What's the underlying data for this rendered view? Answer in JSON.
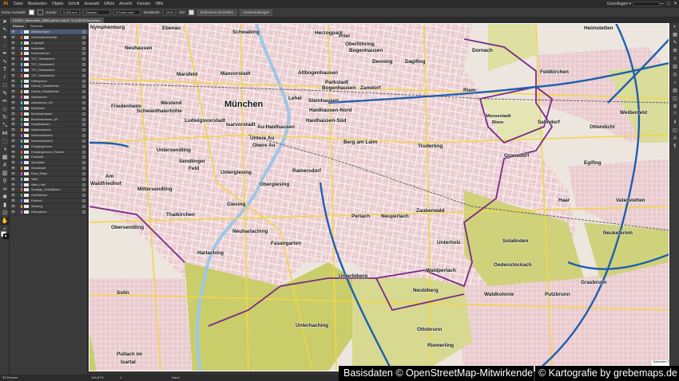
{
  "menubar": {
    "logo": "Ai",
    "items": [
      "Datei",
      "Bearbeiten",
      "Objekt",
      "Schrift",
      "Auswahl",
      "Effekt",
      "Ansicht",
      "Fenster",
      "Hilfe"
    ],
    "workspace": "Grundlagen ▾",
    "window_controls": [
      "—",
      "□",
      "✕"
    ]
  },
  "controlbar": {
    "selection_label": "Keine Auswahl",
    "stroke_label": "Kontur:",
    "stroke_value": "0,353 mm",
    "brush_value": "Gleichm.",
    "style_value": "3 Punkt rund",
    "opacity_label": "Deckkraft:",
    "opacity_value": "100%",
    "style_label": "Stil:",
    "doc_setup_button": "Dokument einrichten",
    "preferences_button": "Voreinstellungen"
  },
  "document_tab": "210001_Muenchen_4000.pdf bei 146,67 % (CMYK/Vorschau)",
  "layers_panel": {
    "tabs": [
      "Ebenen",
      "Zeichenf."
    ],
    "layers": [
      {
        "name": "Allesanzeigen",
        "color": "#4f7cff"
      },
      {
        "name": "Kartenrahmeninhalt",
        "color": "#ff4f4f"
      },
      {
        "name": "Copyright",
        "color": "#3fbf3f"
      },
      {
        "name": "Kartentitel",
        "color": "#4f7cff"
      },
      {
        "name": "Kartenrahmen",
        "color": "#ff9f2f"
      },
      {
        "name": "TXT_Ortsnamen1",
        "color": "#d04fd0"
      },
      {
        "name": "TXT_Ortsnamen2",
        "color": "#4fd0d0"
      },
      {
        "name": "TXT_Ortsnamen3",
        "color": "#4f7cff"
      },
      {
        "name": "TXT_Ortsnamen4",
        "color": "#ff4f4f"
      },
      {
        "name": "Haltegrenze",
        "color": "#3fbf3f"
      },
      {
        "name": "Grenze_Stadtbezirke",
        "color": "#4f7cff"
      },
      {
        "name": "Grenze_Stadtbezirke",
        "color": "#ff9f2f"
      },
      {
        "name": "Autobahnen",
        "color": "#d04fd0"
      },
      {
        "name": "Autobahnen_AS",
        "color": "#4fd0d0"
      },
      {
        "name": "Eisenbahn",
        "color": "#4f7cff"
      },
      {
        "name": "Bundesstrassen",
        "color": "#ff4f4f"
      },
      {
        "name": "Bundesstrassen_AS",
        "color": "#3fbf3f"
      },
      {
        "name": "Hauptstrassen",
        "color": "#4f7cff"
      },
      {
        "name": "Nebenstrassen",
        "color": "#ff9f2f"
      },
      {
        "name": "Nebenstrassen2",
        "color": "#d04fd0"
      },
      {
        "name": "Nebenstrassen3",
        "color": "#4fd0d0"
      },
      {
        "name": "Fußgängerzone",
        "color": "#4f7cff"
      },
      {
        "name": "Fußgängerzone_Flaeche",
        "color": "#ff4f4f"
      },
      {
        "name": "Parkplatz",
        "color": "#3fbf3f"
      },
      {
        "name": "Sportplatz",
        "color": "#4f7cff"
      },
      {
        "name": "Gewaesser",
        "color": "#ff9f2f"
      },
      {
        "name": "Plant_Retail",
        "color": "#d04fd0"
      },
      {
        "name": "Wald",
        "color": "#4fd0d0"
      },
      {
        "name": "Wald_Park",
        "color": "#4f7cff"
      },
      {
        "name": "Sonstige_Grünflächen",
        "color": "#ff4f4f"
      },
      {
        "name": "Grünflächen",
        "color": "#3fbf3f"
      },
      {
        "name": "Friedhof",
        "color": "#4f7cff"
      },
      {
        "name": "Siedlung",
        "color": "#ff9f2f"
      },
      {
        "name": "Hintergrund",
        "color": "#d04fd0"
      }
    ]
  },
  "statusbar": {
    "layers_count": "35 Ebenen",
    "zoom": "146,67%",
    "page": "1",
    "tool": "Hand"
  },
  "map": {
    "places": [
      {
        "name": "Nymphenburg",
        "cls": ""
      },
      {
        "name": "Ebenau",
        "cls": ""
      },
      {
        "name": "Schwabing",
        "cls": ""
      },
      {
        "name": "Herzogpark",
        "cls": ""
      },
      {
        "name": "Priel",
        "cls": ""
      },
      {
        "name": "Oberföhring",
        "cls": ""
      },
      {
        "name": "Bogenhausen",
        "cls": ""
      },
      {
        "name": "Dornach",
        "cls": ""
      },
      {
        "name": "Heimstetten",
        "cls": ""
      },
      {
        "name": "Neuhausen",
        "cls": ""
      },
      {
        "name": "Denning",
        "cls": ""
      },
      {
        "name": "Daglfing",
        "cls": ""
      },
      {
        "name": "Marsfeld",
        "cls": ""
      },
      {
        "name": "Maxvorstadt",
        "cls": ""
      },
      {
        "name": "Altbogenhausen",
        "cls": ""
      },
      {
        "name": "Parkstadt",
        "cls": ""
      },
      {
        "name": "Bogenhausen",
        "cls": ""
      },
      {
        "name": "Zamdorf",
        "cls": ""
      },
      {
        "name": "Feldkirchen",
        "cls": ""
      },
      {
        "name": "Riem",
        "cls": ""
      },
      {
        "name": "Lehel",
        "cls": ""
      },
      {
        "name": "Haidhausen-Nord",
        "cls": ""
      },
      {
        "name": "Steinhausen",
        "cls": ""
      },
      {
        "name": "Westend",
        "cls": ""
      },
      {
        "name": "München",
        "cls": "big"
      },
      {
        "name": "Friedenheim",
        "cls": ""
      },
      {
        "name": "Schwanthalerhöhe",
        "cls": ""
      },
      {
        "name": "Ludwigsvorstadt",
        "cls": ""
      },
      {
        "name": "Isarvorstadt",
        "cls": ""
      },
      {
        "name": "Au-Haidhausen",
        "cls": ""
      },
      {
        "name": "Haidhausen-Süd",
        "cls": ""
      },
      {
        "name": "Messestadt",
        "cls": "small"
      },
      {
        "name": "Riem",
        "cls": "small"
      },
      {
        "name": "Salmdorf",
        "cls": ""
      },
      {
        "name": "Weißenfeld",
        "cls": ""
      },
      {
        "name": "Ottendichl",
        "cls": ""
      },
      {
        "name": "Untere Au",
        "cls": ""
      },
      {
        "name": "Obere Au",
        "cls": ""
      },
      {
        "name": "Berg am Laim",
        "cls": ""
      },
      {
        "name": "Truderling",
        "cls": ""
      },
      {
        "name": "Untersendling",
        "cls": ""
      },
      {
        "name": "Gronsdorf",
        "cls": ""
      },
      {
        "name": "Sendlinger",
        "cls": ""
      },
      {
        "name": "Feld",
        "cls": ""
      },
      {
        "name": "Ramersdorf",
        "cls": ""
      },
      {
        "name": "Eglfing",
        "cls": ""
      },
      {
        "name": "Am",
        "cls": ""
      },
      {
        "name": "Waldfriedhof",
        "cls": ""
      },
      {
        "name": "Untergiesing",
        "cls": ""
      },
      {
        "name": "Mittersendling",
        "cls": ""
      },
      {
        "name": "Obergiesing",
        "cls": ""
      },
      {
        "name": "Haar",
        "cls": ""
      },
      {
        "name": "Vaterstetten",
        "cls": ""
      },
      {
        "name": "Giesing",
        "cls": ""
      },
      {
        "name": "Perlach",
        "cls": ""
      },
      {
        "name": "Zauberwald",
        "cls": ""
      },
      {
        "name": "Neuperlach",
        "cls": ""
      },
      {
        "name": "Thalkirchen",
        "cls": ""
      },
      {
        "name": "Obersendling",
        "cls": ""
      },
      {
        "name": "Neukeferloh",
        "cls": ""
      },
      {
        "name": "Neuharlaching",
        "cls": ""
      },
      {
        "name": "Solalinden",
        "cls": ""
      },
      {
        "name": "Unterholz",
        "cls": ""
      },
      {
        "name": "Fasangarten",
        "cls": ""
      },
      {
        "name": "Harlaching",
        "cls": ""
      },
      {
        "name": "Oedenstockach",
        "cls": ""
      },
      {
        "name": "Waldperlach",
        "cls": ""
      },
      {
        "name": "Unterbiberg",
        "cls": ""
      },
      {
        "name": "Grasbrunn",
        "cls": ""
      },
      {
        "name": "Neubiberg",
        "cls": ""
      },
      {
        "name": "Waldkolonie",
        "cls": ""
      },
      {
        "name": "Putzbrunn",
        "cls": ""
      },
      {
        "name": "Solln",
        "cls": ""
      },
      {
        "name": "Unterhaching",
        "cls": ""
      },
      {
        "name": "Ottobrunn",
        "cls": ""
      },
      {
        "name": "Riemerling",
        "cls": ""
      },
      {
        "name": "Pullach im",
        "cls": ""
      },
      {
        "name": "Isartal",
        "cls": ""
      }
    ],
    "scale_note": "Basisdaten © OpenStreetMap-Mitwirkende  Kartografie © grebemaps.de"
  },
  "credits": {
    "left": "Basisdaten © OpenStreetMap-Mitwirkende",
    "right": "© Kartografie by grebemaps.de"
  }
}
